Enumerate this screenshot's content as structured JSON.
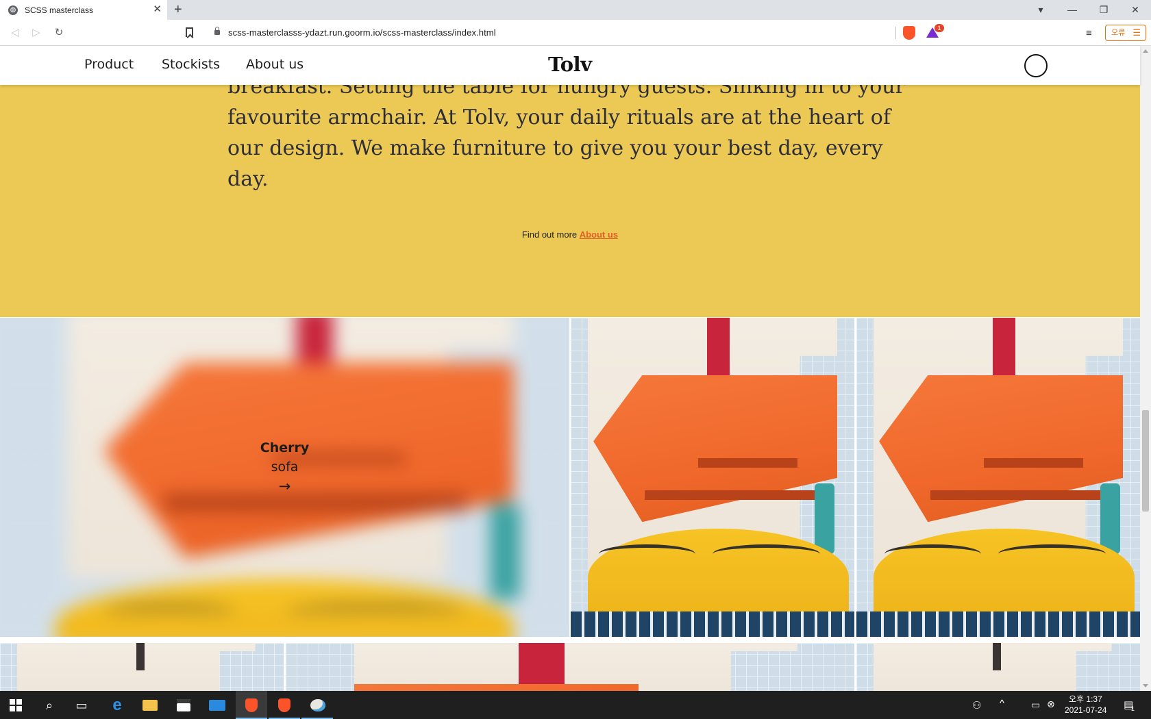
{
  "browser": {
    "tab_title": "SCSS masterclass",
    "tab_close": "✕",
    "new_tab": "+",
    "url": "scss-masterclasss-ydazt.run.goorm.io/scss-masterclass/index.html",
    "rewards_badge": "1",
    "error_button_label": "오류",
    "window_controls": {
      "minimize": "—",
      "restore": "❐",
      "close": "✕",
      "profile": "▾"
    },
    "nav": {
      "back": "◁",
      "forward": "▷",
      "reload": "↻"
    },
    "menu_icon": "☰",
    "playlist_icon": "≡"
  },
  "site": {
    "nav": [
      "Product",
      "Stockists",
      "About us"
    ],
    "brand": "Tolv",
    "intro_text": "Take time for life's little moments. Browsing the news as you eat breakfast. Setting the table for hungry guests. Sinking in to your favourite armchair. At Tolv, your daily rituals are at the heart of our design. We make furniture to give you your best day, every day.",
    "find_more_prefix": "Find out more",
    "find_more_link": "About us",
    "featured_tile": {
      "name": "Cherry",
      "kind": "sofa",
      "arrow": "→"
    },
    "colors": {
      "yellow": "#ecc954",
      "link": "#e45d27"
    }
  },
  "taskbar": {
    "time": "오후 1:37",
    "date": "2021-07-24",
    "notification_count": "1",
    "icons": [
      "windows-start",
      "search",
      "task-view",
      "edge",
      "file-explorer",
      "store",
      "mail",
      "brave",
      "brave",
      "paint"
    ]
  }
}
